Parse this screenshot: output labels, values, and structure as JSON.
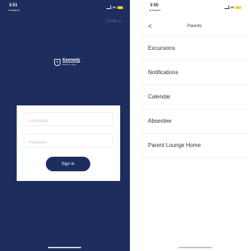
{
  "left_screen": {
    "status": {
      "time": "3:51",
      "back_app": "◂ Search",
      "network": "4G"
    },
    "close_label": "Close ✕",
    "logo": {
      "name": "Kennedy",
      "subtitle": "Baptist College"
    },
    "login": {
      "username_placeholder": "Username",
      "password_placeholder": "Password",
      "signin_label": "Sign In"
    }
  },
  "right_screen": {
    "status": {
      "time": "3:50",
      "back_app": "◂ Search",
      "network": "4G"
    },
    "nav": {
      "back_glyph": "<",
      "title": "Parents"
    },
    "menu_items": [
      {
        "label": "Excursions"
      },
      {
        "label": "Notifications"
      },
      {
        "label": "Calendar"
      },
      {
        "label": "Absentee"
      },
      {
        "label": "Parent Lounge Home"
      }
    ],
    "chevron_glyph": "›"
  },
  "colors": {
    "navy": "#1c2d5e",
    "battery": "#f3d12c"
  }
}
